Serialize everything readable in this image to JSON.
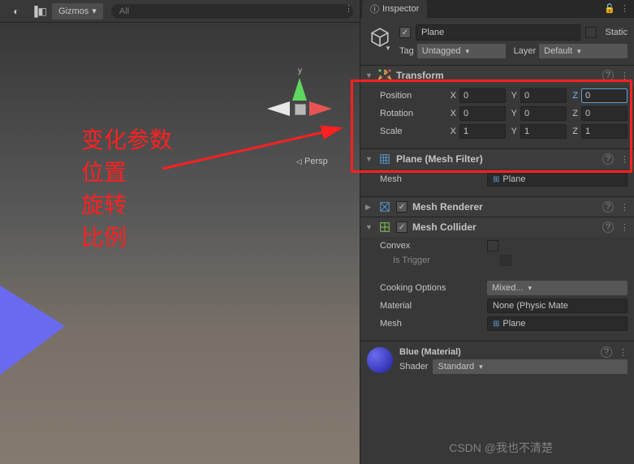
{
  "scene": {
    "gizmos_label": "Gizmos",
    "search_placeholder": "All",
    "persp_label": "Persp",
    "y_axis": "y"
  },
  "annotation": {
    "line1": "变化参数",
    "line2": "位置",
    "line3": "旋转",
    "line4": "比例"
  },
  "inspector": {
    "title": "Inspector",
    "object_name": "Plane",
    "static_label": "Static",
    "tag_label": "Tag",
    "tag_value": "Untagged",
    "layer_label": "Layer",
    "layer_value": "Default"
  },
  "transform": {
    "title": "Transform",
    "position_label": "Position",
    "rotation_label": "Rotation",
    "scale_label": "Scale",
    "x_label": "X",
    "y_label": "Y",
    "z_label": "Z",
    "position": {
      "x": "0",
      "y": "0",
      "z": "0"
    },
    "rotation": {
      "x": "0",
      "y": "0",
      "z": "0"
    },
    "scale": {
      "x": "1",
      "y": "1",
      "z": "1"
    }
  },
  "mesh_filter": {
    "title": "Plane (Mesh Filter)",
    "mesh_label": "Mesh",
    "mesh_value": "Plane"
  },
  "mesh_renderer": {
    "title": "Mesh Renderer"
  },
  "mesh_collider": {
    "title": "Mesh Collider",
    "convex_label": "Convex",
    "trigger_label": "Is Trigger",
    "cooking_label": "Cooking Options",
    "cooking_value": "Mixed...",
    "material_label": "Material",
    "material_value": "None (Physic Mate",
    "mesh_label": "Mesh",
    "mesh_value": "Plane"
  },
  "material": {
    "title": "Blue (Material)",
    "shader_label": "Shader",
    "shader_value": "Standard"
  },
  "watermark": "CSDN @我也不清楚"
}
